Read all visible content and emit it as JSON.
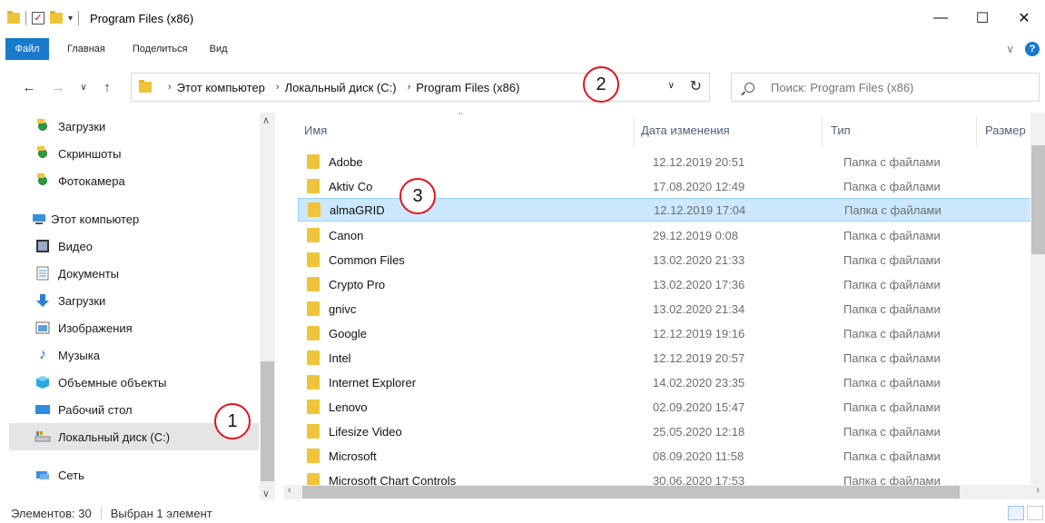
{
  "window": {
    "title": "Program Files (x86)",
    "minimize": "—",
    "maximize": "☐",
    "close": "✕"
  },
  "ribbon": {
    "file": "Файл",
    "tabs": [
      "Главная",
      "Поделиться",
      "Вид"
    ],
    "help": "?"
  },
  "address": {
    "crumbs": [
      "Этот компьютер",
      "Локальный диск (C:)",
      "Program Files (x86)"
    ],
    "search_placeholder": "Поиск: Program Files (x86)"
  },
  "callouts": [
    "1",
    "2",
    "3"
  ],
  "nav": {
    "items": [
      {
        "label": "Загрузки",
        "icon": "downloads-folder-icon"
      },
      {
        "label": "Скриншоты",
        "icon": "screenshots-folder-icon"
      },
      {
        "label": "Фотокамера",
        "icon": "camera-roll-folder-icon"
      },
      {
        "label": "Этот компьютер",
        "icon": "this-pc-icon"
      },
      {
        "label": "Видео",
        "icon": "video-icon"
      },
      {
        "label": "Документы",
        "icon": "documents-icon"
      },
      {
        "label": "Загрузки",
        "icon": "download-arrow-icon"
      },
      {
        "label": "Изображения",
        "icon": "pictures-icon"
      },
      {
        "label": "Музыка",
        "icon": "music-icon"
      },
      {
        "label": "Объемные объекты",
        "icon": "3d-objects-icon"
      },
      {
        "label": "Рабочий стол",
        "icon": "desktop-icon"
      },
      {
        "label": "Локальный диск (C:)",
        "icon": "local-disk-icon"
      },
      {
        "label": "Сеть",
        "icon": "network-icon"
      }
    ]
  },
  "columns": {
    "name": "Имя",
    "date": "Дата изменения",
    "type": "Тип",
    "size": "Размер"
  },
  "files": [
    {
      "name": "Adobe",
      "date": "12.12.2019 20:51",
      "type": "Папка с файлами"
    },
    {
      "name": "Aktiv Co",
      "date": "17.08.2020 12:49",
      "type": "Папка с файлами"
    },
    {
      "name": "almaGRID",
      "date": "12.12.2019 17:04",
      "type": "Папка с файлами"
    },
    {
      "name": "Canon",
      "date": "29.12.2019 0:08",
      "type": "Папка с файлами"
    },
    {
      "name": "Common Files",
      "date": "13.02.2020 21:33",
      "type": "Папка с файлами"
    },
    {
      "name": "Crypto Pro",
      "date": "13.02.2020 17:36",
      "type": "Папка с файлами"
    },
    {
      "name": "gnivc",
      "date": "13.02.2020 21:34",
      "type": "Папка с файлами"
    },
    {
      "name": "Google",
      "date": "12.12.2019 19:16",
      "type": "Папка с файлами"
    },
    {
      "name": "Intel",
      "date": "12.12.2019 20:57",
      "type": "Папка с файлами"
    },
    {
      "name": "Internet Explorer",
      "date": "14.02.2020 23:35",
      "type": "Папка с файлами"
    },
    {
      "name": "Lenovo",
      "date": "02.09.2020 15:47",
      "type": "Папка с файлами"
    },
    {
      "name": "Lifesize Video",
      "date": "25.05.2020 12:18",
      "type": "Папка с файлами"
    },
    {
      "name": "Microsoft",
      "date": "08.09.2020 11:58",
      "type": "Папка с файлами"
    },
    {
      "name": "Microsoft Chart Controls",
      "date": "30.06.2020 17:53",
      "type": "Папка с файлами"
    }
  ],
  "status": {
    "count": "Элементов: 30",
    "selected": "Выбран 1 элемент"
  }
}
